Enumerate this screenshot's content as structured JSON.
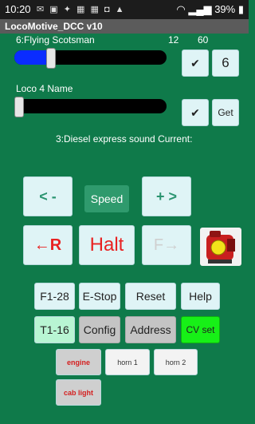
{
  "status": {
    "time": "10:20",
    "battery": "39%"
  },
  "app_title": "LocoMotive_DCC v10",
  "loco1": {
    "name": "6:Flying Scotsman",
    "speed": "12",
    "max": "60",
    "slider_fraction": 0.21,
    "check_label": "✔",
    "number_label": "6"
  },
  "loco2": {
    "name": "Loco 4 Name",
    "slider_fraction": 0.0,
    "check_label": "✔",
    "get_label": "Get"
  },
  "sound_line": "3:Diesel express sound  Current:",
  "controls": {
    "minus": "< -",
    "speed": "Speed",
    "plus": "+ >",
    "reverse": "←R",
    "halt": "Halt",
    "forward": "F→"
  },
  "buttons_row1": [
    "F1-28",
    "E-Stop",
    "Reset",
    "Help"
  ],
  "buttons_row2": [
    "T1-16",
    "Config",
    "Address",
    "CV set"
  ],
  "func_buttons": [
    "engine",
    "horn 1",
    "horn 2",
    "cab light"
  ]
}
